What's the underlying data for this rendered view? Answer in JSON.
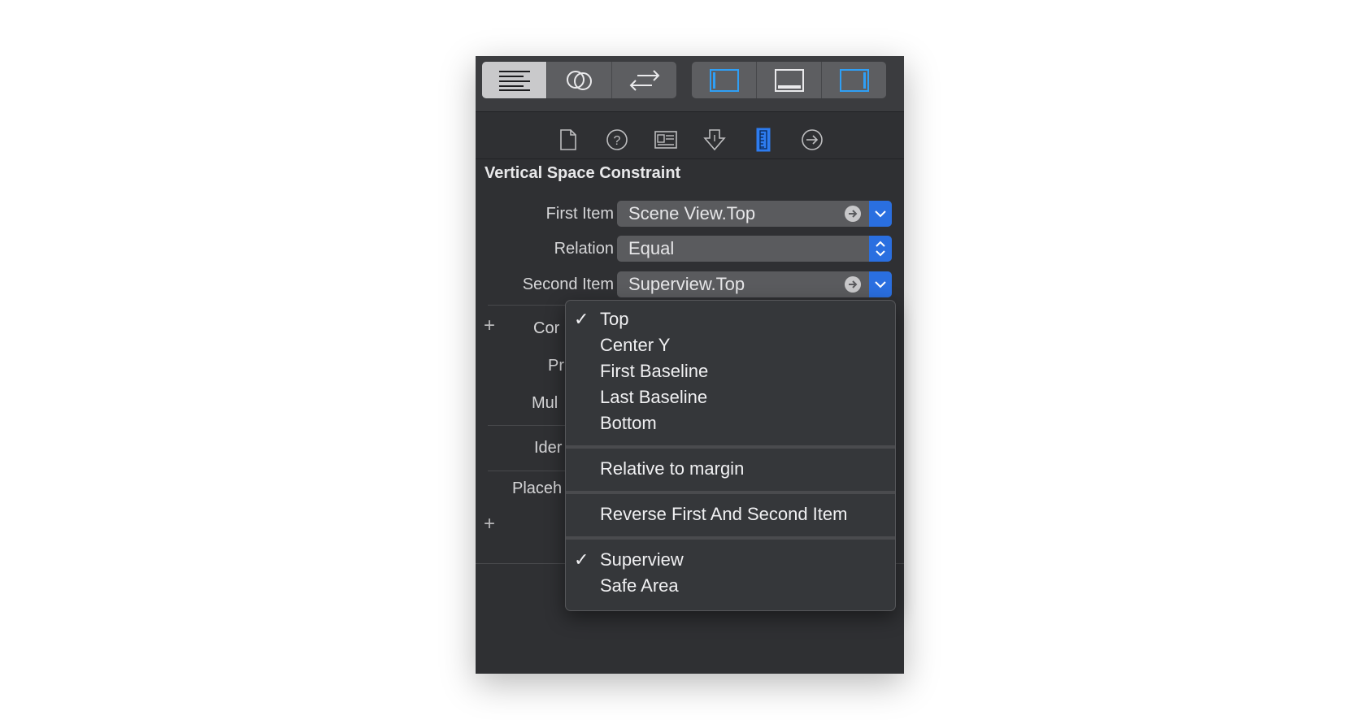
{
  "toolbar": {
    "left_segment": [
      "align-lines-icon",
      "overlapping-circles-icon",
      "swap-arrows-icon"
    ],
    "right_segment": [
      "left-panel-icon",
      "bottom-panel-icon",
      "right-panel-icon"
    ]
  },
  "inspector_tabs": [
    "file-icon",
    "help-icon",
    "identity-icon",
    "attributes-icon",
    "size-ruler-icon",
    "connections-icon"
  ],
  "section": {
    "title": "Vertical Space Constraint"
  },
  "fields": {
    "first_item_label": "First Item",
    "first_item_value": "Scene View.Top",
    "relation_label": "Relation",
    "relation_value": "Equal",
    "second_item_label": "Second Item",
    "second_item_value": "Superview.Top"
  },
  "obscured_labels": {
    "constant": "Cor",
    "priority": "Pr",
    "multiplier": "Mul",
    "identifier": "Ider",
    "placeholder": "Placeh"
  },
  "menu": {
    "group1": [
      {
        "label": "Top",
        "checked": true
      },
      {
        "label": "Center Y",
        "checked": false
      },
      {
        "label": "First Baseline",
        "checked": false
      },
      {
        "label": "Last Baseline",
        "checked": false
      },
      {
        "label": "Bottom",
        "checked": false
      }
    ],
    "relative_to_margin": "Relative to margin",
    "reverse": "Reverse First And Second Item",
    "group3": [
      {
        "label": "Superview",
        "checked": true
      },
      {
        "label": "Safe Area",
        "checked": false
      }
    ],
    "check_glyph": "✓"
  },
  "colors": {
    "accent": "#2a6fe0",
    "panel": "#2f3033",
    "selected_ruler": "#2d7cf0"
  }
}
